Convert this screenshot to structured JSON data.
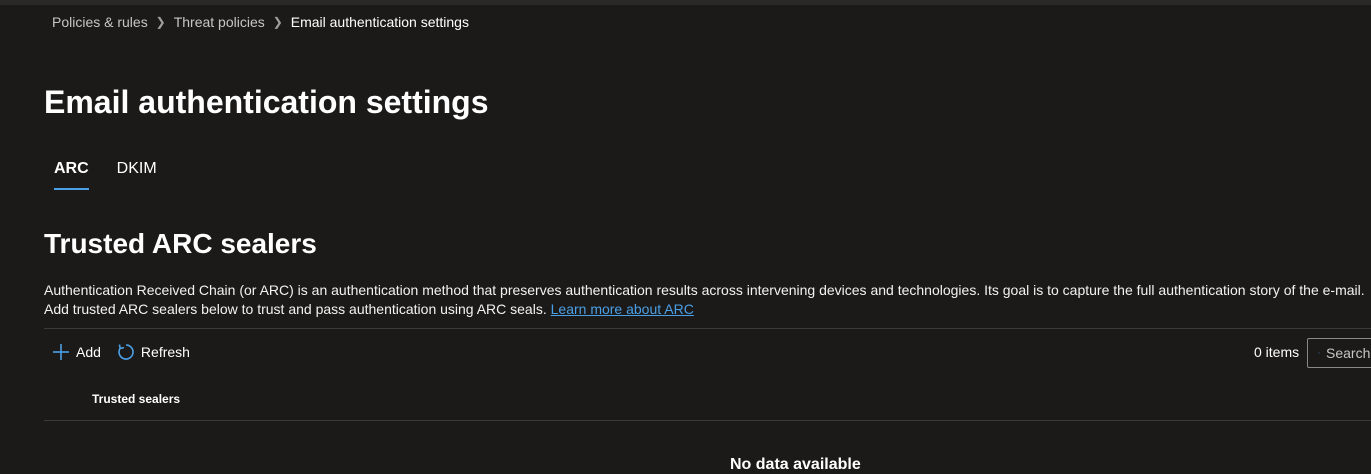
{
  "breadcrumb": [
    {
      "label": "Policies & rules"
    },
    {
      "label": "Threat policies"
    },
    {
      "label": "Email authentication settings"
    }
  ],
  "page_title": "Email authentication settings",
  "tabs": [
    {
      "label": "ARC",
      "active": true
    },
    {
      "label": "DKIM",
      "active": false
    }
  ],
  "section": {
    "title": "Trusted ARC sealers",
    "description_line1": "Authentication Received Chain (or ARC) is an authentication method that preserves authentication results across intervening devices and technologies. Its goal is to capture the full authentication story of the e-mail.",
    "description_line2": "Add trusted ARC sealers below to trust and pass authentication using ARC seals.",
    "learn_more_link": "Learn more about ARC"
  },
  "toolbar": {
    "add_label": "Add",
    "refresh_label": "Refresh",
    "add_icon": "plus-icon",
    "refresh_icon": "refresh-icon"
  },
  "items_count": "0 items",
  "search": {
    "placeholder": "Search",
    "value": "",
    "icon": "search-icon"
  },
  "table": {
    "columns": [
      "Trusted sealers"
    ],
    "rows": [],
    "empty_message": "No data available"
  },
  "colors": {
    "background": "#1b1a19",
    "accent": "#4aa0e6",
    "divider": "#3b3a39"
  }
}
